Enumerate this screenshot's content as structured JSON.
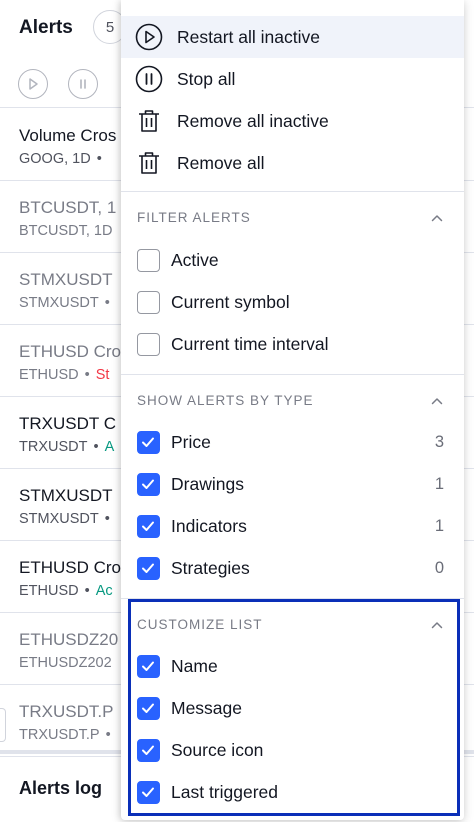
{
  "header": {
    "title": "Alerts",
    "count": "5"
  },
  "rows": [
    {
      "title": "Volume Cros",
      "sub_parts": [
        "GOOG, 1D",
        "•"
      ],
      "status": "",
      "status_color": "",
      "dim": false
    },
    {
      "title": "BTCUSDT, 1",
      "sub_parts": [
        "BTCUSDT, 1D"
      ],
      "status": "",
      "status_color": "",
      "dim": true
    },
    {
      "title": "STMXUSDT",
      "sub_parts": [
        "STMXUSDT",
        "•"
      ],
      "status": "",
      "status_color": "",
      "dim": true
    },
    {
      "title": "ETHUSD Cro",
      "sub_parts": [
        "ETHUSD",
        "•"
      ],
      "status": "St",
      "status_color": "red",
      "dim": true
    },
    {
      "title": "TRXUSDT C",
      "sub_parts": [
        "TRXUSDT",
        "•"
      ],
      "status": "A",
      "status_color": "green",
      "dim": false
    },
    {
      "title": "STMXUSDT",
      "sub_parts": [
        "STMXUSDT",
        "•"
      ],
      "status": "",
      "status_color": "",
      "dim": false
    },
    {
      "title": "ETHUSD Cro",
      "sub_parts": [
        "ETHUSD",
        "•"
      ],
      "status": "Ac",
      "status_color": "green",
      "dim": false
    },
    {
      "title": "ETHUSDZ20",
      "sub_parts": [
        "ETHUSDZ202"
      ],
      "status": "",
      "status_color": "",
      "dim": true
    },
    {
      "title": "TRXUSDT.P",
      "sub_parts": [
        "TRXUSDT.P",
        "•"
      ],
      "status": "",
      "status_color": "",
      "dim": true
    }
  ],
  "log": {
    "title": "Alerts log"
  },
  "menu": {
    "actions": [
      {
        "label": "Restart all inactive",
        "icon": "play-circle-icon"
      },
      {
        "label": "Stop all",
        "icon": "pause-circle-icon"
      },
      {
        "label": "Remove all inactive",
        "icon": "trash-icon"
      },
      {
        "label": "Remove all",
        "icon": "trash-icon"
      }
    ],
    "filter": {
      "title": "FILTER ALERTS",
      "items": [
        {
          "label": "Active",
          "checked": false
        },
        {
          "label": "Current symbol",
          "checked": false
        },
        {
          "label": "Current time interval",
          "checked": false
        }
      ]
    },
    "types": {
      "title": "SHOW ALERTS BY TYPE",
      "items": [
        {
          "label": "Price",
          "checked": true,
          "count": "3"
        },
        {
          "label": "Drawings",
          "checked": true,
          "count": "1"
        },
        {
          "label": "Indicators",
          "checked": true,
          "count": "1"
        },
        {
          "label": "Strategies",
          "checked": true,
          "count": "0"
        }
      ]
    },
    "customize": {
      "title": "CUSTOMIZE LIST",
      "items": [
        {
          "label": "Name",
          "checked": true
        },
        {
          "label": "Message",
          "checked": true
        },
        {
          "label": "Source icon",
          "checked": true
        },
        {
          "label": "Last triggered",
          "checked": true
        }
      ]
    }
  },
  "colors": {
    "accent": "#2962ff",
    "highlight": "#0a2fb8",
    "red": "#f23645",
    "green": "#089981"
  }
}
